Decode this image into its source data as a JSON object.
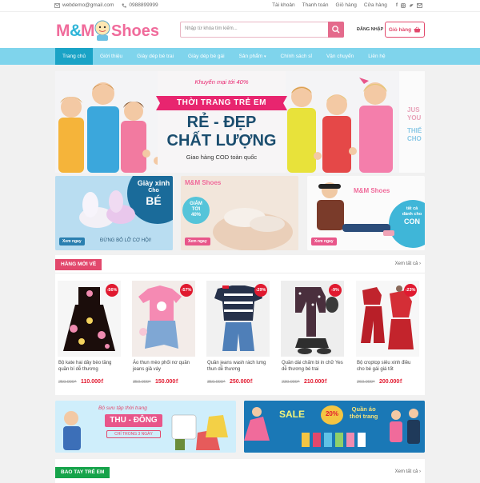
{
  "topbar": {
    "email": "webdemo@gmail.com",
    "phone": "0988899999",
    "links": [
      "Tài khoản",
      "Thanh toán",
      "Giỏ hàng",
      "Cửa hàng"
    ],
    "social_icons": [
      "facebook-icon",
      "instagram-icon",
      "twitter-icon",
      "mail-icon"
    ]
  },
  "header": {
    "logo_text": "M&M Shoes",
    "search_placeholder": "Nhập từ khóa tìm kiếm...",
    "login": "ĐĂNG NHẬP",
    "cart_label": "Giỏ hàng"
  },
  "nav": {
    "items": [
      "Trang chủ",
      "Giới thiệu",
      "Giày dép bé trai",
      "Giày dép bé gái",
      "Sản phẩm",
      "Chính sách sỉ",
      "Vận chuyển",
      "Liên hệ"
    ],
    "active_index": 0
  },
  "banner": {
    "promo": "Khuyến mại tới 40%",
    "title": "THỜI TRANG TRẺ EM",
    "headline1": "RẺ - ĐẸP",
    "headline2": "CHẤT LƯỢNG",
    "sub": "Giao hàng COD toàn quốc",
    "side1": "JUS",
    "side2": "YOU",
    "side3": "THIẾ",
    "side4": "CHO"
  },
  "promos": [
    {
      "title1": "Giày xinh",
      "title2": "Cho",
      "title3": "BÉ",
      "button": "Xem ngay",
      "caption": "ĐỪNG BỎ LỠ CƠ HỘI!"
    },
    {
      "brand": "M&M Shoes",
      "discount1": "GIẢM",
      "discount2": "TỚI",
      "discount3": "40%",
      "button": "Xem ngay"
    },
    {
      "brand": "M&M Shoes",
      "line1": "tất cả",
      "line2": "dành cho",
      "line3": "CON",
      "button": "Xem ngay"
    }
  ],
  "new_products": {
    "title": "HÀNG MỚI VỀ",
    "see_all": "Xem tất cả",
    "items": [
      {
        "name": "Bộ kate hai dây bèo tầng quần bí dễ thương",
        "old": "250.000₫",
        "price": "110.000₫",
        "badge": "-56%"
      },
      {
        "name": "Áo thun mèo phối nơ quần jeans giả váy",
        "old": "350.000₫",
        "price": "150.000₫",
        "badge": "-57%"
      },
      {
        "name": "Quần jeans wash rách lưng thun dễ thương",
        "old": "350.000₫",
        "price": "250.000₫",
        "badge": "-29%"
      },
      {
        "name": "Quần dài chấm bi in chữ Yes dễ thương bé trai",
        "old": "230.000₫",
        "price": "210.000₫",
        "badge": "-9%"
      },
      {
        "name": "Bộ croptop siêu xinh điều cho bé gái giá tốt",
        "old": "260.000₫",
        "price": "200.000₫",
        "badge": "-23%"
      }
    ]
  },
  "promo_banners": [
    {
      "line1": "Bộ sưu tập thời trang",
      "line2": "THU - ĐÔNG",
      "line3": "CHỈ TRONG 3 NGÀY"
    },
    {
      "sale": "SALE",
      "pct": "20%",
      "line1": "Quần áo",
      "line2": "thời trang"
    }
  ],
  "second_section": {
    "title": "BAO TAY TRẺ EM",
    "see_all": "Xem tất cả"
  },
  "colors": {
    "nav": "#7fd4ec",
    "nav_active": "#1aa3c6",
    "brand_pink": "#e2486c",
    "price_red": "#e2192f",
    "section_green": "#16a34a"
  }
}
